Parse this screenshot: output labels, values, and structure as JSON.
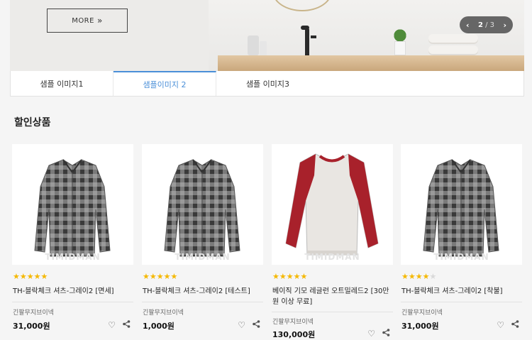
{
  "banner": {
    "more_label": "MORE",
    "more_chevron": "»",
    "pager": {
      "prev": "‹",
      "next": "›",
      "current": "2",
      "separator": " / ",
      "total": "3"
    }
  },
  "tabs": [
    {
      "label": "샘플 이미지1"
    },
    {
      "label": "샘플이미지 2"
    },
    {
      "label": "샘플 이미지3"
    }
  ],
  "section": {
    "title": "할인상품"
  },
  "products": [
    {
      "stars": "★★★★★",
      "stars_off": "",
      "rating": 5,
      "name": "TH-블락체크 셔츠-그레이2 [면세]",
      "vendor": "긴팔무지브이넥",
      "price": "31,000원",
      "watermark": "TIMIDMAN",
      "image": "gray-check-shirt"
    },
    {
      "stars": "★★★★★",
      "stars_off": "",
      "rating": 5,
      "name": "TH-블락체크 셔츠-그레이2 [테스트]",
      "vendor": "긴팔무지브이넥",
      "price": "1,000원",
      "watermark": "TIMIDMAN",
      "image": "gray-check-shirt"
    },
    {
      "stars": "★★★★★",
      "stars_off": "",
      "rating": 5,
      "name": "베이직 기모 레글런 오트밀레드2 [30만원 이상 무료]",
      "vendor": "긴팔무지브이넥",
      "price": "130,000원",
      "watermark": "TIMIDMAN",
      "image": "red-raglan-sweatshirt"
    },
    {
      "stars": "★★★★",
      "stars_off": "★",
      "rating": 4,
      "name": "TH-블락체크 셔츠-그레이2 [착불]",
      "vendor": "긴팔무지브이넥",
      "price": "31,000원",
      "watermark": "TIMIDMAN",
      "image": "gray-check-shirt"
    }
  ],
  "icons": {
    "wish": "heart-icon",
    "share": "share-icon"
  },
  "colors": {
    "accent": "#4a8fd8",
    "star": "#f5b800",
    "sweater_red": "#a8212b"
  }
}
